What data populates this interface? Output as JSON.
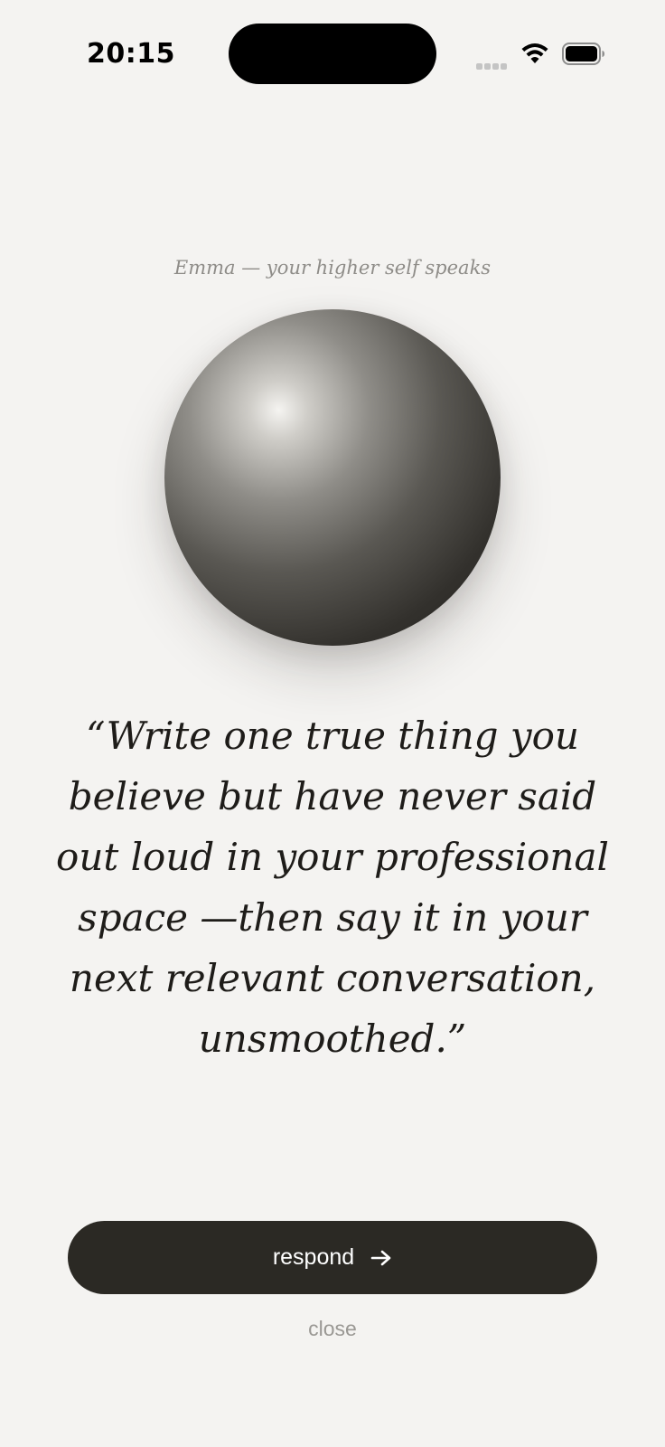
{
  "status_bar": {
    "time": "20:15"
  },
  "icons": {
    "signal": "signal-icon",
    "wifi": "wifi-icon",
    "battery": "battery-icon",
    "arrow": "arrow-right-icon"
  },
  "header": {
    "subtitle": "Emma — your higher self speaks"
  },
  "main": {
    "quote": "“Write one true thing you believe but have never said out loud in your professional space —then say it in your next relevant conversation, unsmoothed.”"
  },
  "actions": {
    "respond_label": "respond",
    "close_label": "close"
  },
  "colors": {
    "background": "#f4f3f1",
    "button": "#2b2924",
    "text": "#1e1c19",
    "muted": "#8e8c88"
  }
}
